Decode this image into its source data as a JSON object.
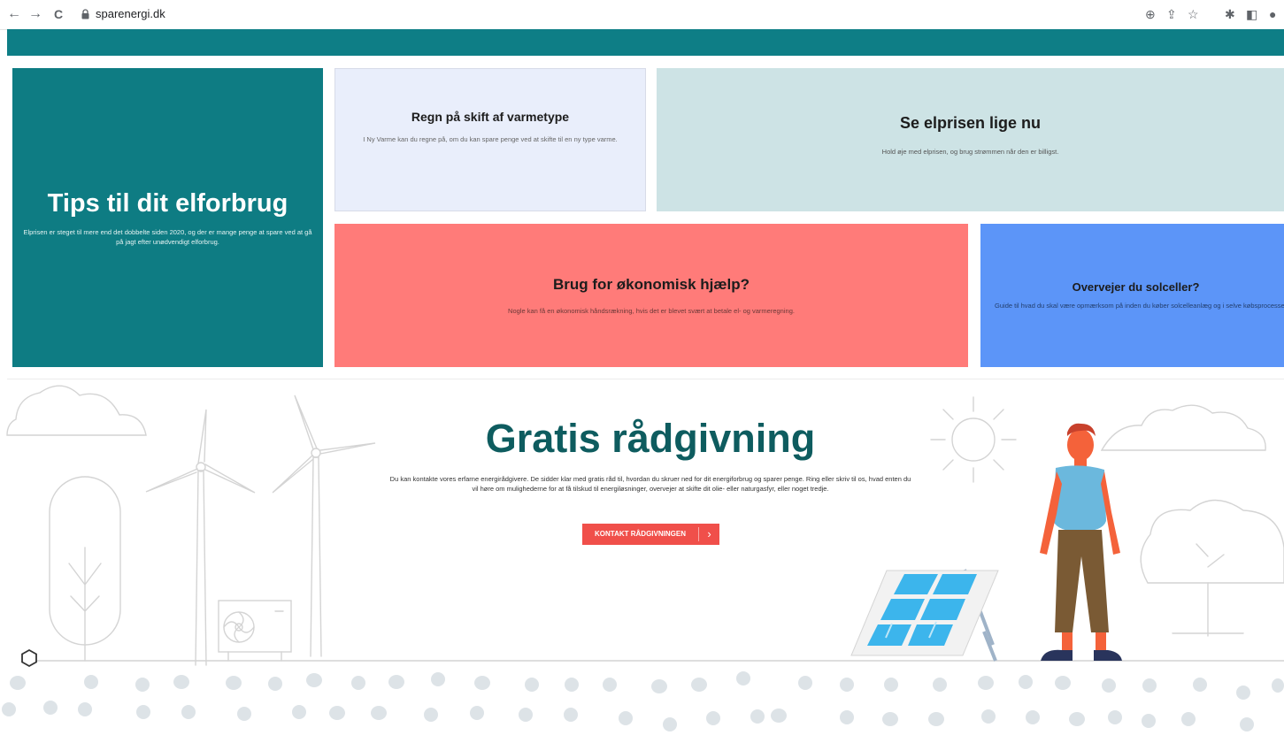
{
  "browser": {
    "url": "sparenergi.dk",
    "back_icon": "←",
    "forward_icon": "→",
    "reload_icon": "C",
    "zoom_icon": "⊕",
    "share_icon": "⇪",
    "star_icon": "☆",
    "extensions_icon": "✱",
    "sidebar_icon": "◧",
    "profile_icon": "●"
  },
  "cards": {
    "tips": {
      "title": "Tips til dit elforbrug",
      "text": "Elprisen er steget til mere end det dobbelte siden 2020, og der er mange penge at spare ved at gå på jagt efter unødvendigt elforbrug."
    },
    "regn": {
      "title": "Regn på skift af varmetype",
      "text": "I Ny Varme kan du regne på, om du kan spare penge ved at skifte til en ny type varme."
    },
    "elpris": {
      "title": "Se elprisen lige nu",
      "text": "Hold øje med elprisen, og brug strømmen når den er billigst."
    },
    "okonomisk": {
      "title": "Brug for økonomisk hjælp?",
      "text": "Nogle kan få en økonomisk håndsrækning, hvis det er blevet svært at betale el- og varmeregning."
    },
    "solceller": {
      "title": "Overvejer du solceller?",
      "text": "Guide til hvad du skal være opmærksom på inden du køber solcelleanlæg og i selve købsprocessen."
    }
  },
  "hero": {
    "title": "Gratis rådgivning",
    "text": "Du kan kontakte vores erfarne energirådgivere. De sidder klar med gratis råd til, hvordan du skruer ned for dit energiforbrug og sparer penge. Ring eller skriv til os, hvad enten du vil høre om mulighederne for at få tilskud til energiløsninger, overvejer at skifte dit olie- eller naturgasfyr, eller noget tredje.",
    "cta_label": "KONTAKT RÅDGIVNINGEN",
    "cta_arrow": "›"
  },
  "colors": {
    "teal": "#0e7c83",
    "cta": "#f04f4a",
    "coral": "#ff7b79",
    "blue": "#5c95f8",
    "light_teal": "#cde3e5",
    "light_blue": "#e9eefb"
  }
}
